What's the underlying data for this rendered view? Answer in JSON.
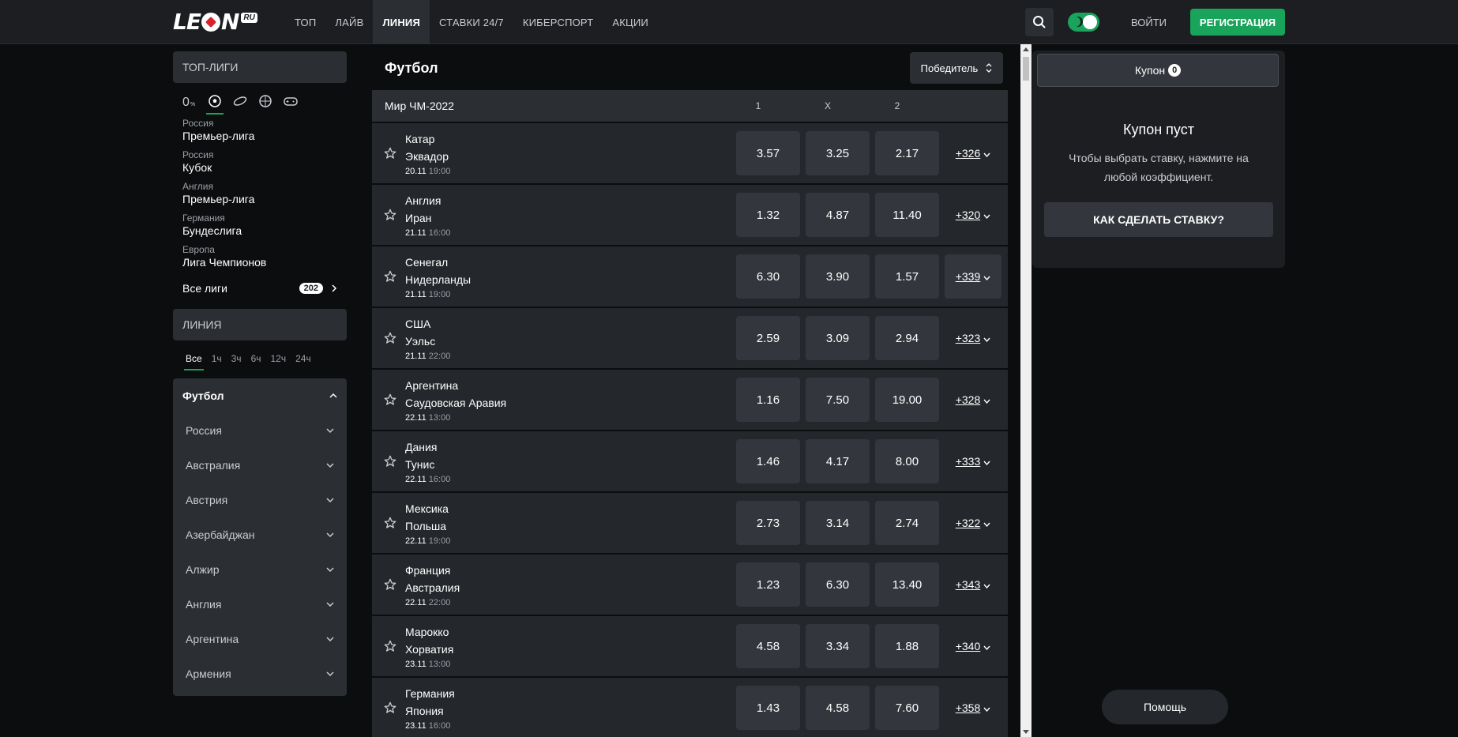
{
  "brand": {
    "logo_text_left": "LE",
    "logo_text_right": "N",
    "logo_ru": "RU"
  },
  "nav": [
    {
      "label": "ТОП"
    },
    {
      "label": "ЛАЙВ"
    },
    {
      "label": "ЛИНИЯ",
      "active": true
    },
    {
      "label": "СТАВКИ 24/7"
    },
    {
      "label": "КИБЕРСПОРТ"
    },
    {
      "label": "АКЦИИ"
    }
  ],
  "header": {
    "login": "ВОЙТИ",
    "register": "РЕГИСТРАЦИЯ"
  },
  "sidebar": {
    "top_leagues_title": "ТОП-ЛИГИ",
    "leagues": [
      {
        "country": "Россия",
        "name": "Премьер-лига"
      },
      {
        "country": "Россия",
        "name": "Кубок"
      },
      {
        "country": "Англия",
        "name": "Премьер-лига"
      },
      {
        "country": "Германия",
        "name": "Бундеслига"
      },
      {
        "country": "Европа",
        "name": "Лига Чемпионов"
      }
    ],
    "all_leagues": "Все лиги",
    "all_leagues_count": "202",
    "line_title": "ЛИНИЯ",
    "time_filters": [
      "Все",
      "1ч",
      "3ч",
      "6ч",
      "12ч",
      "24ч"
    ],
    "sport": "Футбол",
    "countries": [
      "Россия",
      "Австралия",
      "Австрия",
      "Азербайджан",
      "Алжир",
      "Англия",
      "Аргентина",
      "Армения"
    ]
  },
  "main": {
    "title": "Футбол",
    "market": "Победитель",
    "group": "Мир ЧМ-2022",
    "cols": [
      "1",
      "X",
      "2"
    ],
    "events": [
      {
        "home": "Катар",
        "away": "Эквадор",
        "date": "20.11",
        "time": "19:00",
        "o1": "3.57",
        "ox": "3.25",
        "o2": "2.17",
        "more": "+326"
      },
      {
        "home": "Англия",
        "away": "Иран",
        "date": "21.11",
        "time": "16:00",
        "o1": "1.32",
        "ox": "4.87",
        "o2": "11.40",
        "more": "+320"
      },
      {
        "home": "Сенегал",
        "away": "Нидерланды",
        "date": "21.11",
        "time": "19:00",
        "o1": "6.30",
        "ox": "3.90",
        "o2": "1.57",
        "more": "+339"
      },
      {
        "home": "США",
        "away": "Уэльс",
        "date": "21.11",
        "time": "22:00",
        "o1": "2.59",
        "ox": "3.09",
        "o2": "2.94",
        "more": "+323"
      },
      {
        "home": "Аргентина",
        "away": "Саудовская Аравия",
        "date": "22.11",
        "time": "13:00",
        "o1": "1.16",
        "ox": "7.50",
        "o2": "19.00",
        "more": "+328"
      },
      {
        "home": "Дания",
        "away": "Тунис",
        "date": "22.11",
        "time": "16:00",
        "o1": "1.46",
        "ox": "4.17",
        "o2": "8.00",
        "more": "+333"
      },
      {
        "home": "Мексика",
        "away": "Польша",
        "date": "22.11",
        "time": "19:00",
        "o1": "2.73",
        "ox": "3.14",
        "o2": "2.74",
        "more": "+322"
      },
      {
        "home": "Франция",
        "away": "Австралия",
        "date": "22.11",
        "time": "22:00",
        "o1": "1.23",
        "ox": "6.30",
        "o2": "13.40",
        "more": "+343"
      },
      {
        "home": "Марокко",
        "away": "Хорватия",
        "date": "23.11",
        "time": "13:00",
        "o1": "4.58",
        "ox": "3.34",
        "o2": "1.88",
        "more": "+340"
      },
      {
        "home": "Германия",
        "away": "Япония",
        "date": "23.11",
        "time": "16:00",
        "o1": "1.43",
        "ox": "4.58",
        "o2": "7.60",
        "more": "+358"
      }
    ]
  },
  "coupon": {
    "tab": "Купон",
    "count": "0",
    "empty_title": "Купон пуст",
    "empty_text": "Чтобы выбрать ставку, нажмите на любой коэффициент.",
    "howto": "КАК СДЕЛАТЬ СТАВКУ?"
  },
  "help": "Помощь",
  "colors": {
    "accent": "#1aa35a",
    "bg": "#0c0d0f",
    "panel": "#2b2e33"
  }
}
